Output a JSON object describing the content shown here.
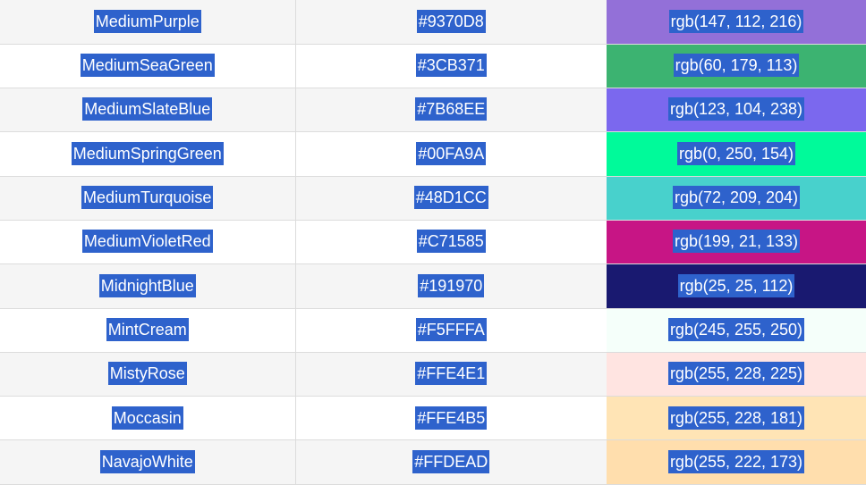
{
  "colors": [
    {
      "name": "MediumPurple",
      "hex": "#9370D8",
      "rgb": "rgb(147, 112, 216)",
      "swatch": "#9370D8"
    },
    {
      "name": "MediumSeaGreen",
      "hex": "#3CB371",
      "rgb": "rgb(60, 179, 113)",
      "swatch": "#3CB371"
    },
    {
      "name": "MediumSlateBlue",
      "hex": "#7B68EE",
      "rgb": "rgb(123, 104, 238)",
      "swatch": "#7B68EE"
    },
    {
      "name": "MediumSpringGreen",
      "hex": "#00FA9A",
      "rgb": "rgb(0, 250, 154)",
      "swatch": "#00FA9A"
    },
    {
      "name": "MediumTurquoise",
      "hex": "#48D1CC",
      "rgb": "rgb(72, 209, 204)",
      "swatch": "#48D1CC"
    },
    {
      "name": "MediumVioletRed",
      "hex": "#C71585",
      "rgb": "rgb(199, 21, 133)",
      "swatch": "#C71585"
    },
    {
      "name": "MidnightBlue",
      "hex": "#191970",
      "rgb": "rgb(25, 25, 112)",
      "swatch": "#191970"
    },
    {
      "name": "MintCream",
      "hex": "#F5FFFA",
      "rgb": "rgb(245, 255, 250)",
      "swatch": "#F5FFFA"
    },
    {
      "name": "MistyRose",
      "hex": "#FFE4E1",
      "rgb": "rgb(255, 228, 225)",
      "swatch": "#FFE4E1"
    },
    {
      "name": "Moccasin",
      "hex": "#FFE4B5",
      "rgb": "rgb(255, 228, 181)",
      "swatch": "#FFE4B5"
    },
    {
      "name": "NavajoWhite",
      "hex": "#FFDEAD",
      "rgb": "rgb(255, 222, 173)",
      "swatch": "#FFDEAD"
    }
  ],
  "highlight_color": "#2E62CC"
}
